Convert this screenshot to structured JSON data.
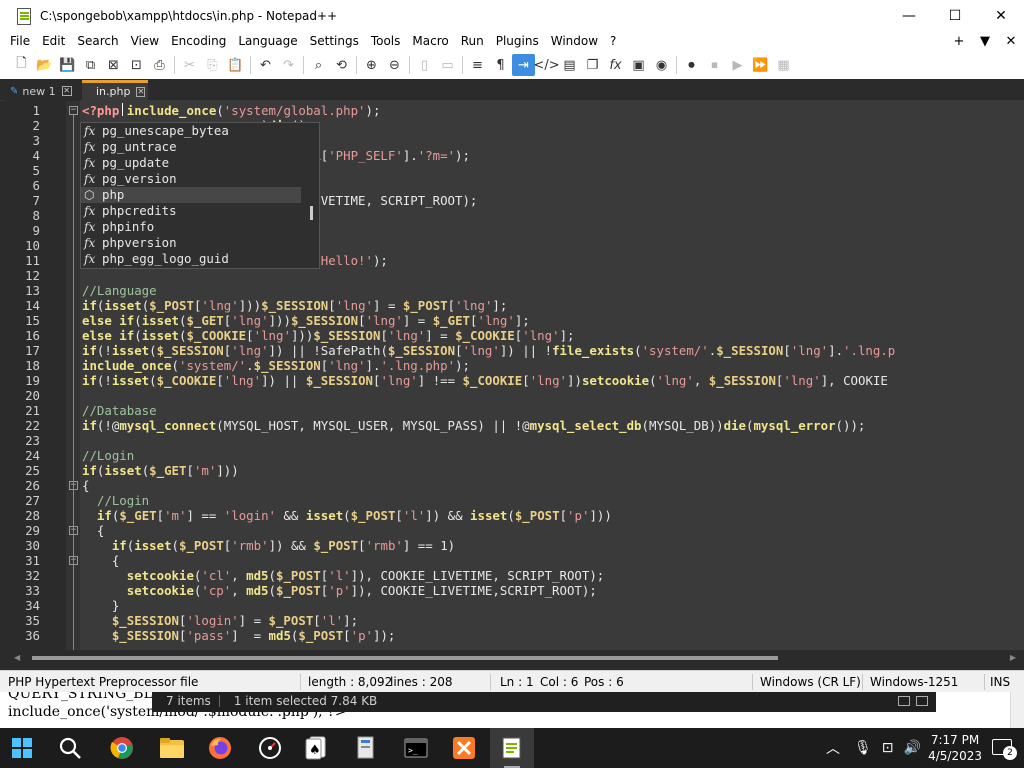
{
  "window": {
    "title": "C:\\spongebob\\xampp\\htdocs\\in.php - Notepad++"
  },
  "menu": [
    "File",
    "Edit",
    "Search",
    "View",
    "Encoding",
    "Language",
    "Settings",
    "Tools",
    "Macro",
    "Run",
    "Plugins",
    "Window",
    "?"
  ],
  "menu_right": [
    "+",
    "▼",
    "✕"
  ],
  "tabs": [
    {
      "label": "new 1"
    },
    {
      "label": "in.php"
    }
  ],
  "editor": {
    "lines": [
      {
        "n": "1",
        "html": "<span class='c-tag'>&lt;?php</span> <span class='c-kw'>include_once</span><span class='c-op'>(</span><span class='c-str'>'system/global.php'</span><span class='c-op'>);</span>"
      },
      {
        "n": "2",
        "html": "<span class='c-op'>                        )</span><span class='c-kw'>die</span><span class='c-op'>();</span>"
      },
      {
        "n": "3",
        "html": ""
      },
      {
        "n": "4",
        "html": "<span class='c-op'>                        </span><span class='c-var'>$_SERVER</span><span class='c-op'>[</span><span class='c-str'>'PHP_SELF'</span><span class='c-op'>].</span><span class='c-str'>'?m='</span><span class='c-op'>);</span>"
      },
      {
        "n": "5",
        "html": ""
      },
      {
        "n": "6",
        "html": ""
      },
      {
        "n": "7",
        "html": "<span class='c-tx'>                        OOKIE_LIVETIME, SCRIPT_ROOT);</span>"
      },
      {
        "n": "8",
        "html": ""
      },
      {
        "n": "9",
        "html": ""
      },
      {
        "n": "10",
        "html": ""
      },
      {
        "n": "11",
        "html": "<span class='c-op'>                        G))</span><span class='c-kw'>die</span><span class='c-op'>(</span><span class='c-str'>'Hello!'</span><span class='c-op'>);</span>"
      },
      {
        "n": "12",
        "html": ""
      },
      {
        "n": "13",
        "html": "<span class='c-cm'>//Language</span>"
      },
      {
        "n": "14",
        "html": "<span class='c-kw'>if</span><span class='c-op'>(</span><span class='c-kw'>isset</span><span class='c-op'>(</span><span class='c-var'>$_POST</span><span class='c-op'>[</span><span class='c-str'>'lng'</span><span class='c-op'>]))</span><span class='c-var'>$_SESSION</span><span class='c-op'>[</span><span class='c-str'>'lng'</span><span class='c-op'>] = </span><span class='c-var'>$_POST</span><span class='c-op'>[</span><span class='c-str'>'lng'</span><span class='c-op'>];</span>"
      },
      {
        "n": "15",
        "html": "<span class='c-kw'>else if</span><span class='c-op'>(</span><span class='c-kw'>isset</span><span class='c-op'>(</span><span class='c-var'>$_GET</span><span class='c-op'>[</span><span class='c-str'>'lng'</span><span class='c-op'>]))</span><span class='c-var'>$_SESSION</span><span class='c-op'>[</span><span class='c-str'>'lng'</span><span class='c-op'>] = </span><span class='c-var'>$_GET</span><span class='c-op'>[</span><span class='c-str'>'lng'</span><span class='c-op'>];</span>"
      },
      {
        "n": "16",
        "html": "<span class='c-kw'>else if</span><span class='c-op'>(</span><span class='c-kw'>isset</span><span class='c-op'>(</span><span class='c-var'>$_COOKIE</span><span class='c-op'>[</span><span class='c-str'>'lng'</span><span class='c-op'>]))</span><span class='c-var'>$_SESSION</span><span class='c-op'>[</span><span class='c-str'>'lng'</span><span class='c-op'>] = </span><span class='c-var'>$_COOKIE</span><span class='c-op'>[</span><span class='c-str'>'lng'</span><span class='c-op'>];</span>"
      },
      {
        "n": "17",
        "html": "<span class='c-kw'>if</span><span class='c-op'>(!</span><span class='c-kw'>isset</span><span class='c-op'>(</span><span class='c-var'>$_SESSION</span><span class='c-op'>[</span><span class='c-str'>'lng'</span><span class='c-op'>]) || !</span><span class='c-tx'>SafePath</span><span class='c-op'>(</span><span class='c-var'>$_SESSION</span><span class='c-op'>[</span><span class='c-str'>'lng'</span><span class='c-op'>]) || !</span><span class='c-kw'>file_exists</span><span class='c-op'>(</span><span class='c-str'>'system/'</span><span class='c-op'>.</span><span class='c-var'>$_SESSION</span><span class='c-op'>[</span><span class='c-str'>'lng'</span><span class='c-op'>].</span><span class='c-str'>'.lng.p</span>"
      },
      {
        "n": "18",
        "html": "<span class='c-kw'>include_once</span><span class='c-op'>(</span><span class='c-str'>'system/'</span><span class='c-op'>.</span><span class='c-var'>$_SESSION</span><span class='c-op'>[</span><span class='c-str'>'lng'</span><span class='c-op'>].</span><span class='c-str'>'.lng.php'</span><span class='c-op'>);</span>"
      },
      {
        "n": "19",
        "html": "<span class='c-kw'>if</span><span class='c-op'>(!</span><span class='c-kw'>isset</span><span class='c-op'>(</span><span class='c-var'>$_COOKIE</span><span class='c-op'>[</span><span class='c-str'>'lng'</span><span class='c-op'>]) || </span><span class='c-var'>$_SESSION</span><span class='c-op'>[</span><span class='c-str'>'lng'</span><span class='c-op'>] !== </span><span class='c-var'>$_COOKIE</span><span class='c-op'>[</span><span class='c-str'>'lng'</span><span class='c-op'>])</span><span class='c-kw'>setcookie</span><span class='c-op'>(</span><span class='c-str'>'lng'</span><span class='c-op'>, </span><span class='c-var'>$_SESSION</span><span class='c-op'>[</span><span class='c-str'>'lng'</span><span class='c-op'>], </span><span class='c-tx'>COOKIE</span>"
      },
      {
        "n": "20",
        "html": ""
      },
      {
        "n": "21",
        "html": "<span class='c-cm'>//Database</span>"
      },
      {
        "n": "22",
        "html": "<span class='c-kw'>if</span><span class='c-op'>(!@</span><span class='c-kw'>mysql_connect</span><span class='c-op'>(</span><span class='c-tx'>MYSQL_HOST, MYSQL_USER, MYSQL_PASS</span><span class='c-op'>) || !@</span><span class='c-kw'>mysql_select_db</span><span class='c-op'>(</span><span class='c-tx'>MYSQL_DB</span><span class='c-op'>))</span><span class='c-kw'>die</span><span class='c-op'>(</span><span class='c-kw'>mysql_error</span><span class='c-op'>());</span>"
      },
      {
        "n": "23",
        "html": ""
      },
      {
        "n": "24",
        "html": "<span class='c-cm'>//Login</span>"
      },
      {
        "n": "25",
        "html": "<span class='c-kw'>if</span><span class='c-op'>(</span><span class='c-kw'>isset</span><span class='c-op'>(</span><span class='c-var'>$_GET</span><span class='c-op'>[</span><span class='c-str'>'m'</span><span class='c-op'>]))</span>"
      },
      {
        "n": "26",
        "html": "<span class='c-op'>{</span>"
      },
      {
        "n": "27",
        "html": "<span class='c-cm'>  //Login</span>"
      },
      {
        "n": "28",
        "html": "<span class='c-op'>  </span><span class='c-kw'>if</span><span class='c-op'>(</span><span class='c-var'>$_GET</span><span class='c-op'>[</span><span class='c-str'>'m'</span><span class='c-op'>] == </span><span class='c-str'>'login'</span><span class='c-op'> &amp;&amp; </span><span class='c-kw'>isset</span><span class='c-op'>(</span><span class='c-var'>$_POST</span><span class='c-op'>[</span><span class='c-str'>'l'</span><span class='c-op'>]) &amp;&amp; </span><span class='c-kw'>isset</span><span class='c-op'>(</span><span class='c-var'>$_POST</span><span class='c-op'>[</span><span class='c-str'>'p'</span><span class='c-op'>]))</span>"
      },
      {
        "n": "29",
        "html": "<span class='c-op'>  {</span>"
      },
      {
        "n": "30",
        "html": "<span class='c-op'>    </span><span class='c-kw'>if</span><span class='c-op'>(</span><span class='c-kw'>isset</span><span class='c-op'>(</span><span class='c-var'>$_POST</span><span class='c-op'>[</span><span class='c-str'>'rmb'</span><span class='c-op'>]) &amp;&amp; </span><span class='c-var'>$_POST</span><span class='c-op'>[</span><span class='c-str'>'rmb'</span><span class='c-op'>] == </span><span class='c-tx'>1</span><span class='c-op'>)</span>"
      },
      {
        "n": "31",
        "html": "<span class='c-op'>    {</span>"
      },
      {
        "n": "32",
        "html": "<span class='c-op'>      </span><span class='c-kw'>setcookie</span><span class='c-op'>(</span><span class='c-str'>'cl'</span><span class='c-op'>, </span><span class='c-kw'>md5</span><span class='c-op'>(</span><span class='c-var'>$_POST</span><span class='c-op'>[</span><span class='c-str'>'l'</span><span class='c-op'>]), </span><span class='c-tx'>COOKIE_LIVETIME, SCRIPT_ROOT</span><span class='c-op'>);</span>"
      },
      {
        "n": "33",
        "html": "<span class='c-op'>      </span><span class='c-kw'>setcookie</span><span class='c-op'>(</span><span class='c-str'>'cp'</span><span class='c-op'>, </span><span class='c-kw'>md5</span><span class='c-op'>(</span><span class='c-var'>$_POST</span><span class='c-op'>[</span><span class='c-str'>'p'</span><span class='c-op'>]), </span><span class='c-tx'>COOKIE_LIVETIME,SCRIPT_ROOT</span><span class='c-op'>);</span>"
      },
      {
        "n": "34",
        "html": "<span class='c-op'>    }</span>"
      },
      {
        "n": "35",
        "html": "<span class='c-op'>    </span><span class='c-var'>$_SESSION</span><span class='c-op'>[</span><span class='c-str'>'login'</span><span class='c-op'>] = </span><span class='c-var'>$_POST</span><span class='c-op'>[</span><span class='c-str'>'l'</span><span class='c-op'>];</span>"
      },
      {
        "n": "36",
        "html": "<span class='c-op'>    </span><span class='c-var'>$_SESSION</span><span class='c-op'>[</span><span class='c-str'>'pass'</span><span class='c-op'>]  = </span><span class='c-kw'>md5</span><span class='c-op'>(</span><span class='c-var'>$_POST</span><span class='c-op'>[</span><span class='c-str'>'p'</span><span class='c-op'>]);</span>"
      }
    ]
  },
  "autocomplete": {
    "items": [
      {
        "icon": "fx",
        "label": "pg_unescape_bytea"
      },
      {
        "icon": "fx",
        "label": "pg_untrace"
      },
      {
        "icon": "fx",
        "label": "pg_update"
      },
      {
        "icon": "fx",
        "label": "pg_version"
      },
      {
        "icon": "cube",
        "label": "php",
        "selected": true
      },
      {
        "icon": "fx",
        "label": "phpcredits"
      },
      {
        "icon": "fx",
        "label": "phpinfo"
      },
      {
        "icon": "fx",
        "label": "phpversion"
      },
      {
        "icon": "fx",
        "label": "php_egg_logo_guid"
      }
    ]
  },
  "statusbar": {
    "file_type": "PHP Hypertext Preprocessor file",
    "length": "length : 8,092",
    "lines": "lines : 208",
    "ln": "Ln : 1",
    "col": "Col : 6",
    "pos": "Pos : 6",
    "eol": "Windows (CR LF)",
    "encoding": "Windows-1251",
    "mode": "INS"
  },
  "background": {
    "line1": "QUERY_STRING_BL",
    "line2": "include_once('system/mod/'.$module.'.php'); ?>",
    "explorer_items": "7 items",
    "explorer_selected": "1 item selected  7.84 KB"
  },
  "taskbar": {
    "time": "7:17 PM",
    "date": "4/5/2023",
    "notifications": "2"
  },
  "colors": {
    "accent": "#3d8ee0",
    "tab_active": "#e8a033",
    "editor_bg": "#3a3a3a"
  }
}
